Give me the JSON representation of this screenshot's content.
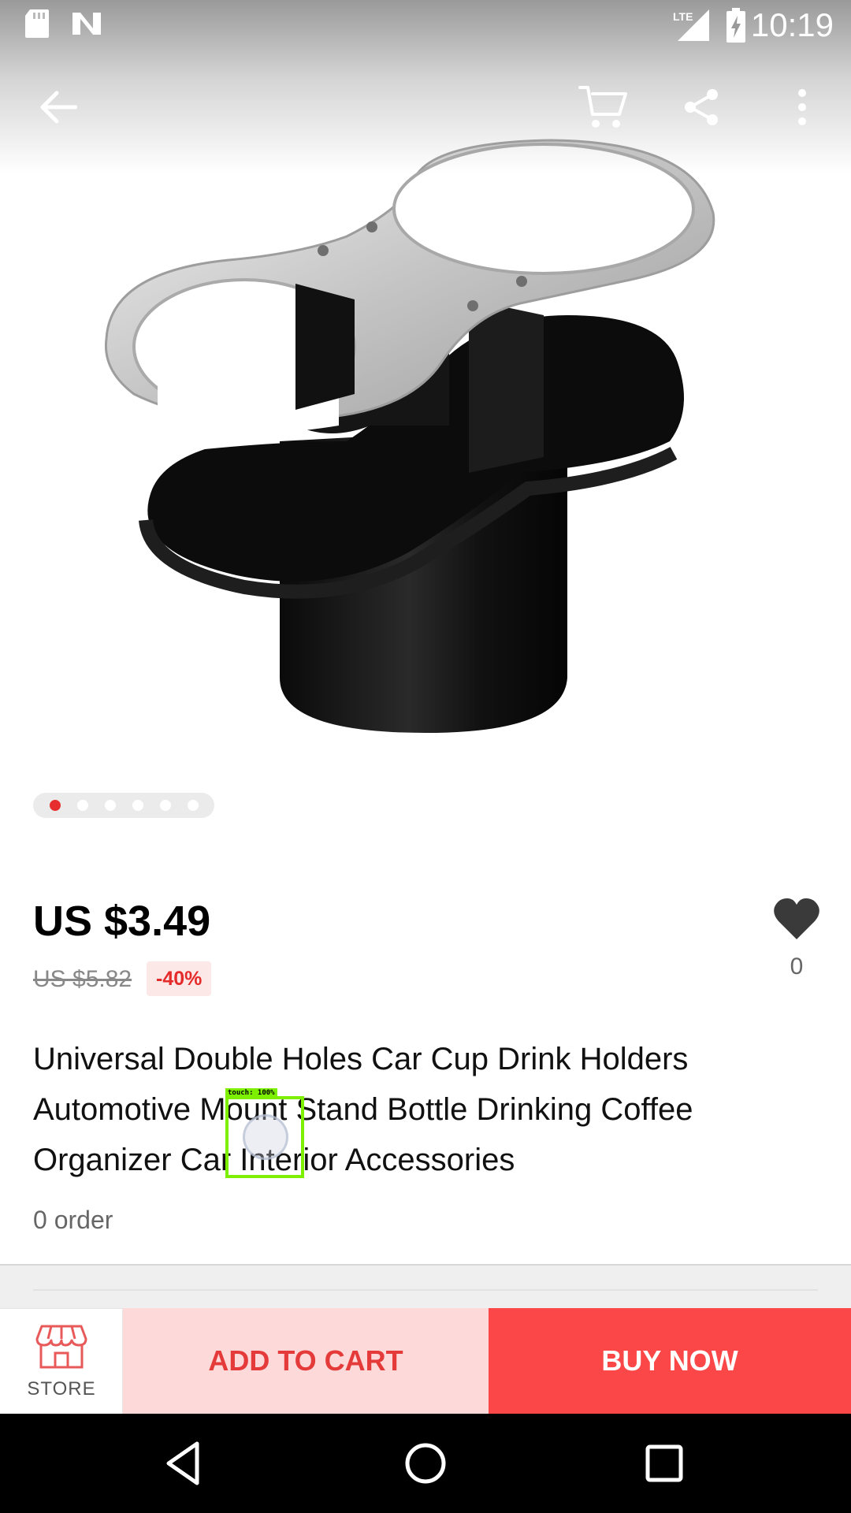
{
  "status_bar": {
    "time": "10:19",
    "network": "LTE",
    "icons": [
      "sd-card-icon",
      "notification-n-icon",
      "lte-signal-icon",
      "battery-charging-icon"
    ]
  },
  "toolbar": {
    "icons": [
      "back-arrow-icon",
      "cart-icon",
      "share-icon",
      "more-vert-icon"
    ]
  },
  "gallery": {
    "image_count": 6,
    "active_index": 0
  },
  "product": {
    "price": "US $3.49",
    "original_price": "US $5.82",
    "discount": "-40%",
    "wishlist_count": "0",
    "title": "Universal Double Holes Car Cup Drink Holders Automotive Mount Stand Bottle Drinking Coffee Organizer Car Interior Accessories",
    "orders": "0 order"
  },
  "action_bar": {
    "store_label": "STORE",
    "add_to_cart_label": "ADD TO CART",
    "buy_now_label": "BUY NOW"
  },
  "colors": {
    "accent": "#fb4747",
    "accent_light": "#fdd9d9",
    "active_dot": "#e62e2e",
    "touch_overlay": "#7cf000"
  },
  "touch_indicator": {
    "label": "touch: 100%"
  }
}
